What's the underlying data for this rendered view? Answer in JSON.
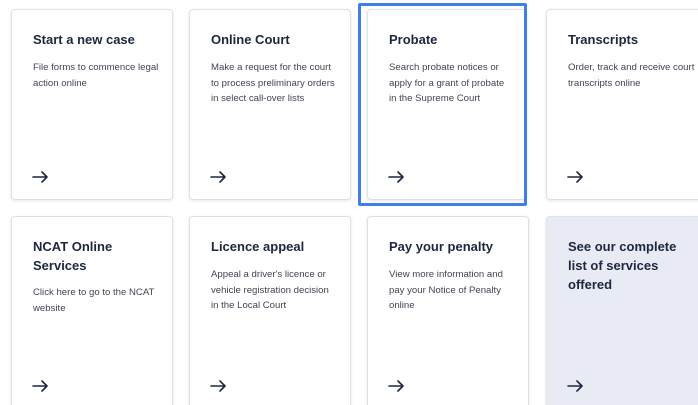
{
  "cards": [
    {
      "title": "Start a new case",
      "description": "File forms to commence legal action online",
      "arrow_icon": "arrow-right-icon"
    },
    {
      "title": "Online Court",
      "description": "Make a request for the court to process preliminary orders in select call-over lists",
      "arrow_icon": "arrow-right-icon"
    },
    {
      "title": "Probate",
      "description": "Search probate notices or apply for a grant of probate in the Supreme Court",
      "arrow_icon": "arrow-right-icon"
    },
    {
      "title": "Transcripts",
      "description": "Order, track and receive court transcripts online",
      "arrow_icon": "arrow-right-icon"
    },
    {
      "title": "NCAT Online Services",
      "description": "Click here to go to the NCAT website",
      "arrow_icon": "arrow-right-icon"
    },
    {
      "title": "Licence appeal",
      "description": "Appeal a driver's licence or vehicle registration decision in the Local Court",
      "arrow_icon": "arrow-right-icon"
    },
    {
      "title": "Pay your penalty",
      "description": "View more information and pay your Notice of Penalty online",
      "arrow_icon": "arrow-right-icon"
    },
    {
      "title": "See our complete list of services offered",
      "description": "",
      "arrow_icon": "arrow-right-icon"
    }
  ],
  "colors": {
    "title_text": "#1c2740",
    "body_text": "#3f4552",
    "shaded_card_bg": "#e8ebf3",
    "focus_ring": "#3f7fe6"
  }
}
